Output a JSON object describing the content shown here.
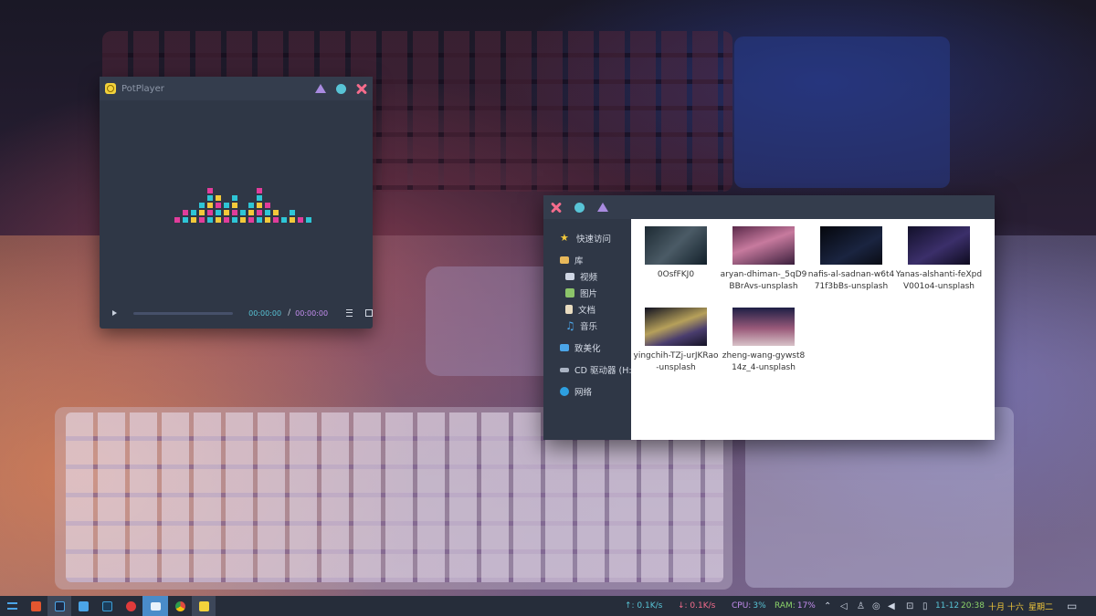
{
  "potplayer": {
    "title": "PotPlayer",
    "time_current": "00:00:00",
    "time_separator": "/",
    "time_total": "00:00:00",
    "visualizer_colors": [
      "#e13d9b",
      "#2ec5d6",
      "#f3c93a"
    ]
  },
  "window_controls": {
    "minimize_color": "#a98be0",
    "maximize_color": "#58c4d6",
    "close_color": "#f46c8c"
  },
  "explorer": {
    "nav": {
      "quick_access": "快速访问",
      "library": "库",
      "videos": "视频",
      "pictures": "图片",
      "documents": "文档",
      "music": "音乐",
      "this_pc": "致美化",
      "cd_drive": "CD 驱动器 (H:)",
      "network": "网络"
    },
    "files": [
      {
        "name": "0OsfFKJ0"
      },
      {
        "name": "aryan-dhiman-_5qD9BBrAvs-unsplash"
      },
      {
        "name": "nafis-al-sadnan-w6t471f3bBs-unsplash"
      },
      {
        "name": "Yanas-alshanti-feXpdV001o4-unsplash"
      },
      {
        "name": "yingchih-TZj-urJKRao-unsplash"
      },
      {
        "name": "zheng-wang-gywst814z_4-unsplash"
      }
    ]
  },
  "taskbar": {
    "apps": [
      "menu-icon",
      "office-icon",
      "photoshop-icon",
      "notepad-icon",
      "terminal-icon",
      "netease-music-icon",
      "file-explorer-icon",
      "chrome-icon",
      "potplayer-icon"
    ],
    "upload": "↑: 0.1K/s",
    "download": "↓: 0.1K/s",
    "cpu_label": "CPU:",
    "cpu_value": "3%",
    "ram_label": "RAM:",
    "ram_value": "17%",
    "date": "11-12",
    "time": "20:38",
    "lunar": "十月 十六",
    "weekday": "星期二"
  }
}
